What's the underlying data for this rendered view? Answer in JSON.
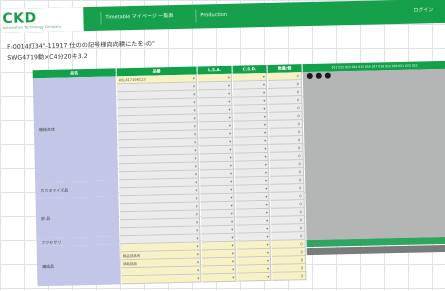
{
  "header": {
    "logo": "CKD",
    "logo_sub": "Automation Technology Company",
    "tabs": [
      "Timetable マイページ 一覧表",
      "Production"
    ],
    "right_label": "ログイン"
  },
  "page": {
    "title_line1": "F-0014灯34\"-11917 仕のの記号様向向積にたを-の\"",
    "title_line2": "SWG4719動×C4分20キ3.2"
  },
  "table": {
    "headers": [
      "品名",
      "品番",
      "L.S.A.",
      "C.S.D.",
      "数量/個",
      "011 012 013 014 015 016 017 018 019 020 021 022 023"
    ],
    "first_row_part": "ASL41719RC13",
    "categories": [
      "機械本体",
      "カスタマイズ品",
      "部 品",
      "アクセサリ",
      "構成品"
    ],
    "last_rows_part": [
      "製品部品名",
      "消耗部品"
    ],
    "row_num": "0",
    "dropdown_arrow": "▾"
  },
  "schedule": {
    "markers": 3
  },
  "colors": {
    "accent": "#17a04c",
    "category_bg": "#c4c6e8",
    "cell_bg": "#ebebeb",
    "input_bg": "#f6f2c6",
    "gantt_bg": "#b4b6b5"
  }
}
